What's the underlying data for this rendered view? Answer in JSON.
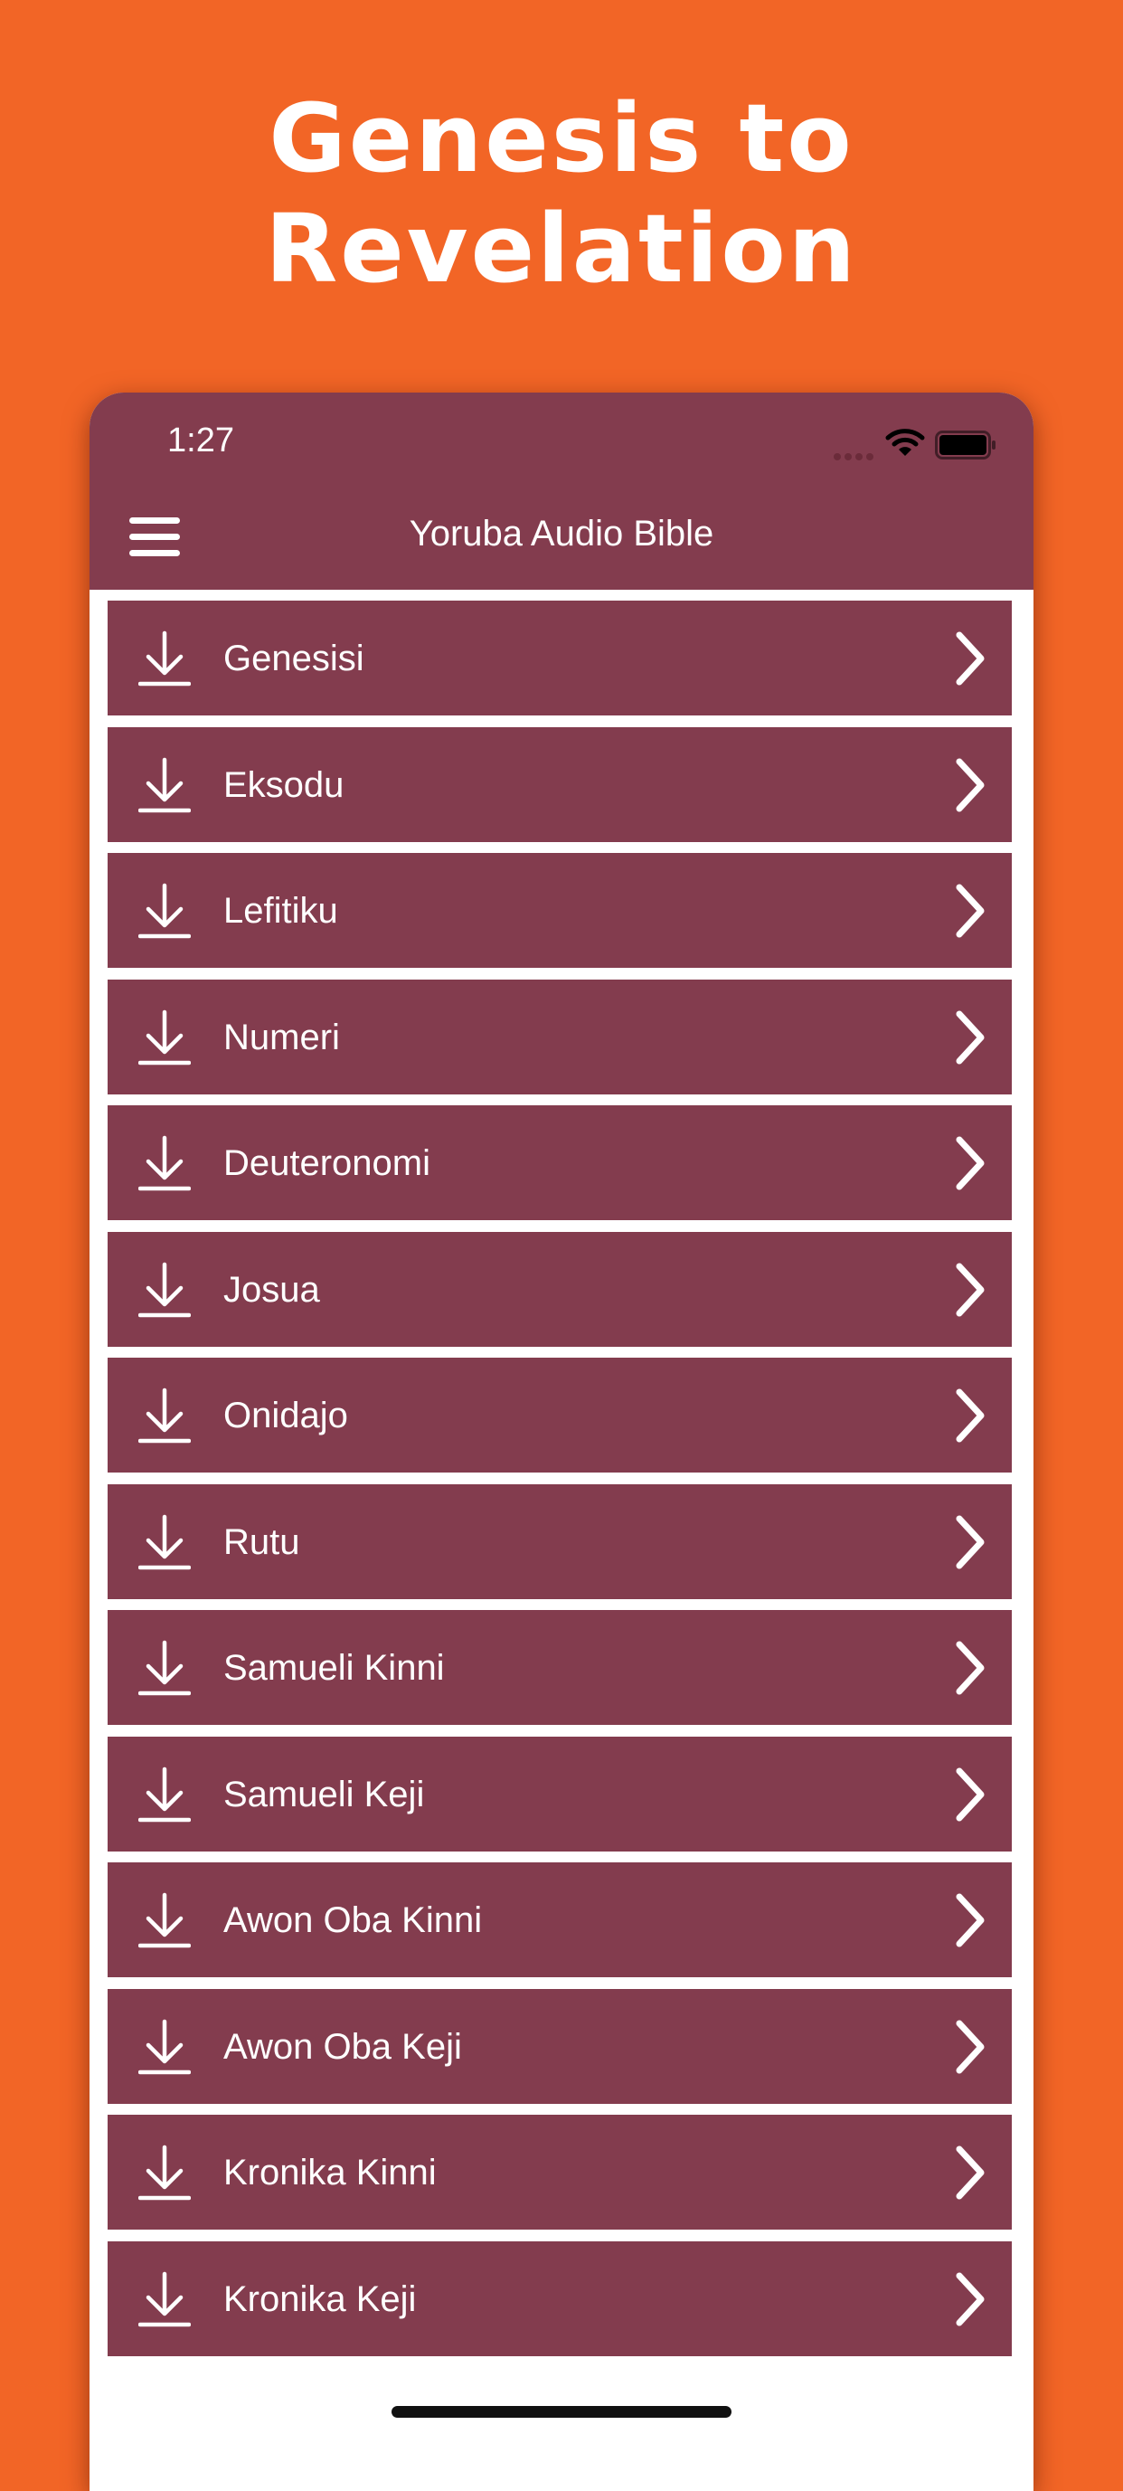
{
  "promo": {
    "title_line1": "Genesis to",
    "title_line2": "Revelation"
  },
  "status_bar": {
    "time": "1:27"
  },
  "header": {
    "title": "Yoruba Audio Bible",
    "menu_icon": "hamburger-menu-icon"
  },
  "books": [
    {
      "name": "Genesisi"
    },
    {
      "name": "Eksodu"
    },
    {
      "name": "Lefitiku"
    },
    {
      "name": "Numeri"
    },
    {
      "name": "Deuteronomi"
    },
    {
      "name": "Josua"
    },
    {
      "name": "Onidajo"
    },
    {
      "name": "Rutu"
    },
    {
      "name": "Samueli Kinni"
    },
    {
      "name": "Samueli Keji"
    },
    {
      "name": "Awon Oba Kinni"
    },
    {
      "name": "Awon Oba Keji"
    },
    {
      "name": "Kronika Kinni"
    },
    {
      "name": "Kronika Keji"
    }
  ],
  "icons": {
    "row_left": "download-icon",
    "row_right": "chevron-right-icon"
  },
  "colors": {
    "background": "#f26526",
    "bar": "#833c4e",
    "text": "#ffffff"
  }
}
